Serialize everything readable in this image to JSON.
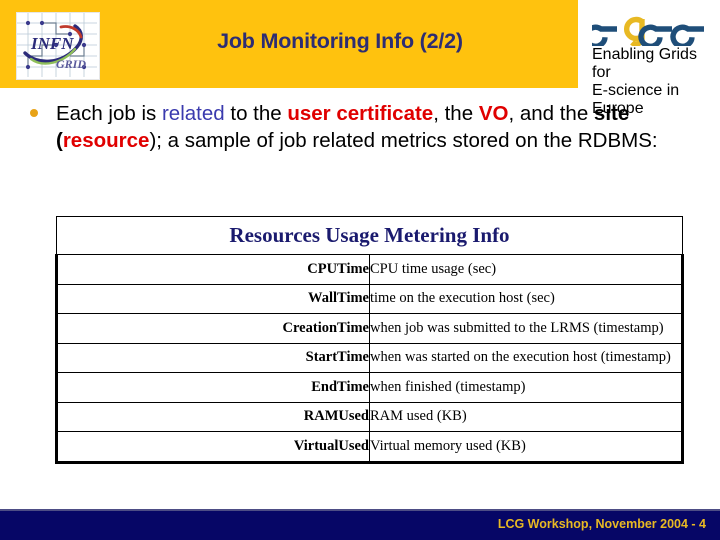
{
  "header": {
    "title": "Job Monitoring Info (2/2)",
    "band_color": "#FFC20E",
    "title_color": "#2D2D73",
    "left_logo": {
      "name": "INFN GRID",
      "line1": "INFN",
      "line2": "GRID"
    },
    "right_logo": {
      "name": "EGEE",
      "wordmark": "egee",
      "tagline_line1": "Enabling Grids for",
      "tagline_line2": "E-science in Europe"
    }
  },
  "body": {
    "bullet": {
      "segment_1": "Each job is ",
      "segment_2_blue": "related",
      "segment_3": " to the ",
      "segment_4_red": "user certificate",
      "segment_5": ", the ",
      "segment_6_red": "VO",
      "segment_7": ", and the ",
      "segment_8_bold": "site",
      "segment_9": " (",
      "segment_10_red": "resource",
      "segment_11": "); a sample of job related metrics stored on the RDBMS:"
    }
  },
  "table": {
    "caption": "Resources Usage Metering Info",
    "caption_color": "#1A1A6E",
    "rows": [
      {
        "name": "CPUTime",
        "desc": "CPU time usage (sec)"
      },
      {
        "name": "WallTime",
        "desc": "time on the execution host (sec)"
      },
      {
        "name": "CreationTime",
        "desc": "when job was submitted to the LRMS (timestamp)"
      },
      {
        "name": "StartTime",
        "desc": "when was started on the execution host (timestamp)"
      },
      {
        "name": "EndTime",
        "desc": "when finished (timestamp)"
      },
      {
        "name": "RAMUsed",
        "desc": "RAM used (KB)"
      },
      {
        "name": "VirtualUsed",
        "desc": "Virtual memory used (KB)"
      }
    ]
  },
  "footer": {
    "text": "LCG Workshop,  November 2004 - 4",
    "bar_color": "#060666",
    "text_color": "#E8B923"
  }
}
